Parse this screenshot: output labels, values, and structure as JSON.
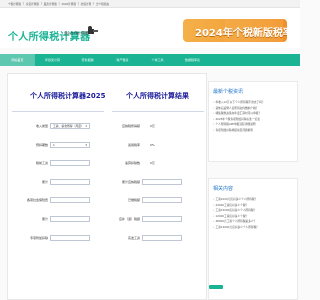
{
  "topbar": {
    "links": [
      "个税计算器",
      "房贷计算器",
      "股票计算器",
      "2020计算器",
      "社保计算",
      "合个税新政"
    ]
  },
  "header": {
    "logo_text": "个人所得税计算器",
    "slogan": "您身边个税计算器",
    "banner_text": "2024年个税新版税率表"
  },
  "nav": {
    "items": [
      {
        "label": "网站首页",
        "active": true
      },
      {
        "label": "年终奖计算",
        "active": false
      },
      {
        "label": "劳务报酬",
        "active": false
      },
      {
        "label": "财产租赁",
        "active": false
      },
      {
        "label": "个体工商",
        "active": false
      },
      {
        "label": "数据税率表",
        "active": false
      }
    ]
  },
  "calculator": {
    "title": "个人所得税计算器2025",
    "rows": [
      {
        "label": "收入类型",
        "value": "工资、薪金所得（月度）"
      },
      {
        "label": "预扣期数",
        "value": "1"
      },
      {
        "label": "税前工资",
        "value": ""
      },
      {
        "label": "累计",
        "value": ""
      },
      {
        "label": "各项社会保险费",
        "value": ""
      },
      {
        "label": "累计",
        "value": ""
      },
      {
        "label": "专项附加扣除",
        "value": ""
      }
    ]
  },
  "results": {
    "title": "个人所得税计算结果",
    "rows": [
      {
        "label": "应纳税所得额",
        "value": "0元"
      },
      {
        "label": "适用税率",
        "value": "0%"
      },
      {
        "label": "速算扣除数",
        "value": "0元"
      },
      {
        "label": "累计应纳税额",
        "value": ""
      },
      {
        "label": "已缴税额",
        "value": ""
      },
      {
        "label": "应补（退）税额",
        "value": ""
      },
      {
        "label": "实发工资",
        "value": ""
      }
    ]
  },
  "sidebar": {
    "latest_title": "最新个税资讯",
    "latest_items": [
      "年收入12万以下个人所得税不用交了吗？",
      "退休后返聘人员所得如何缴纳个税？",
      "哪些税惠政策在年度汇算时可以申报？",
      "2025年个税专项附加扣除标准一览表",
      "个人所得税APP申报流程详细说明",
      "专项附加扣除填报常见问题解答"
    ],
    "related_title": "相关内容",
    "related_items": [
      "工资1000元应扣多少个人所得税？",
      "24000工资应扣多少个税？",
      "工资15000应扣多少个人所得税？",
      "12000工资应扣多少个税？",
      "48000元工资个人所得税是多少？",
      "工资14000元应扣多少个人所得税？"
    ]
  },
  "colors": {
    "brand": "#1ab394",
    "banner": "#f2a138",
    "title": "#1d1d9e",
    "link": "#1a73c9"
  }
}
